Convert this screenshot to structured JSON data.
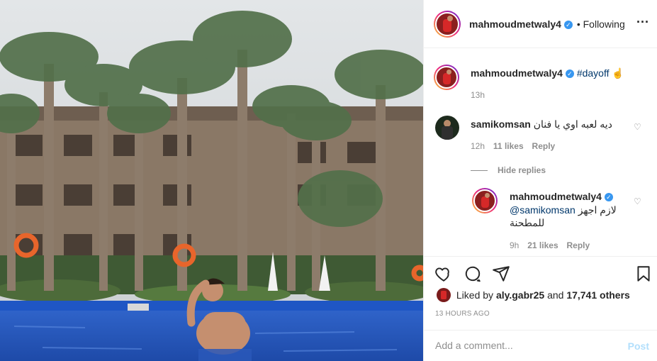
{
  "post": {
    "author": "mahmoudmetwaly4",
    "following_label": "• Following",
    "more_icon": "more-horizontal-icon"
  },
  "caption": {
    "username": "mahmoudmetwaly4",
    "hashtag": "#dayoff",
    "emoji_text": "  ☝",
    "time": "13h"
  },
  "comments": [
    {
      "username": "samikomsan",
      "text": "ديه لعبه اوي يا فنان",
      "emoji": "",
      "time": "12h",
      "likes": "11 likes",
      "reply_label": "Reply"
    }
  ],
  "hide_replies_label": "Hide replies",
  "reply": {
    "username": "mahmoudmetwaly4",
    "mention": "@samikomsan",
    "text_line1": "لازم اجهز",
    "text_line2": "للمطحنة ",
    "time": "9h",
    "likes": "21 likes",
    "reply_label": "Reply"
  },
  "actions": {
    "like_icon": "heart-icon",
    "comment_icon": "comment-icon",
    "share_icon": "share-icon",
    "save_icon": "bookmark-icon"
  },
  "likes": {
    "prefix": "Liked by",
    "user": "aly.gabr25",
    "middle": "and",
    "others": "17,741 others"
  },
  "timestamp": "13 hours ago",
  "add_comment": {
    "placeholder": "Add a comment...",
    "post_label": "Post"
  },
  "colors": {
    "accent_link": "#00376b",
    "verified_blue": "#3897f0",
    "post_button_disabled": "#b2dffc",
    "muted": "#8e8e8e"
  }
}
